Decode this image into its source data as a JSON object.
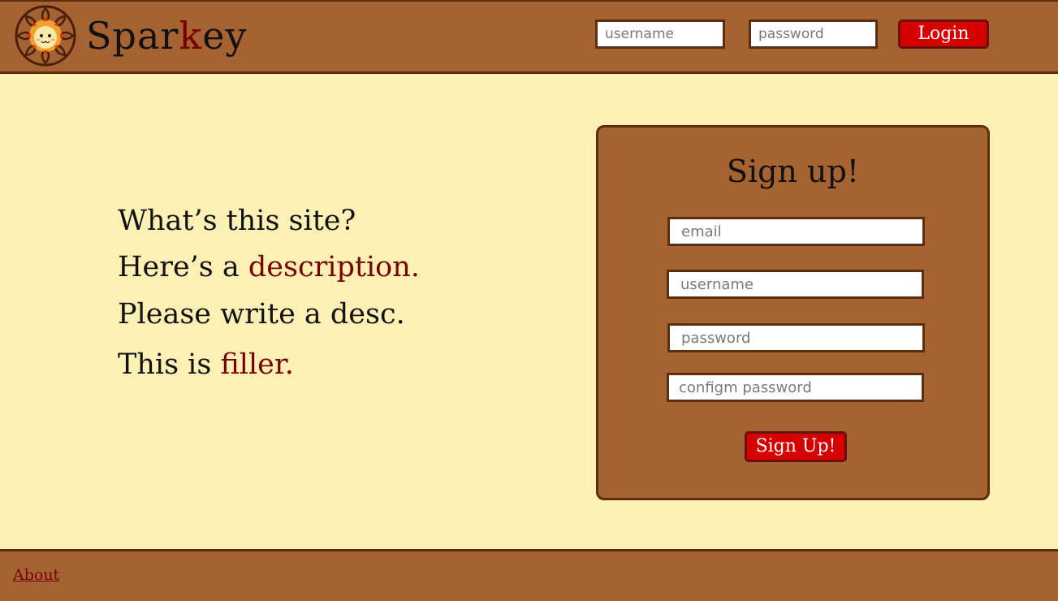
{
  "header": {
    "brand_prefix": "Spar",
    "brand_accent": "k",
    "brand_suffix": "ey",
    "logo_icon": "sun-face-logo",
    "login": {
      "username_placeholder": "username",
      "password_placeholder": "password",
      "button_label": "Login"
    }
  },
  "description": {
    "line1": "What’s this site?",
    "line2_prefix": "Here’s a ",
    "line2_highlight": "description.",
    "line3": "Please write a desc.",
    "line4_prefix": "This is ",
    "line4_highlight": "filler."
  },
  "signup": {
    "title": "Sign up!",
    "email_placeholder": "email",
    "username_placeholder": "username",
    "password_placeholder": "password",
    "confirm_placeholder": "configm password",
    "button_label": "Sign Up!"
  },
  "footer": {
    "about_label": "About"
  },
  "colors": {
    "background": "#fdf0b4",
    "bar": "#a46331",
    "border": "#5c2e0f",
    "accent_text": "#7a0000",
    "button": "#d60000"
  }
}
